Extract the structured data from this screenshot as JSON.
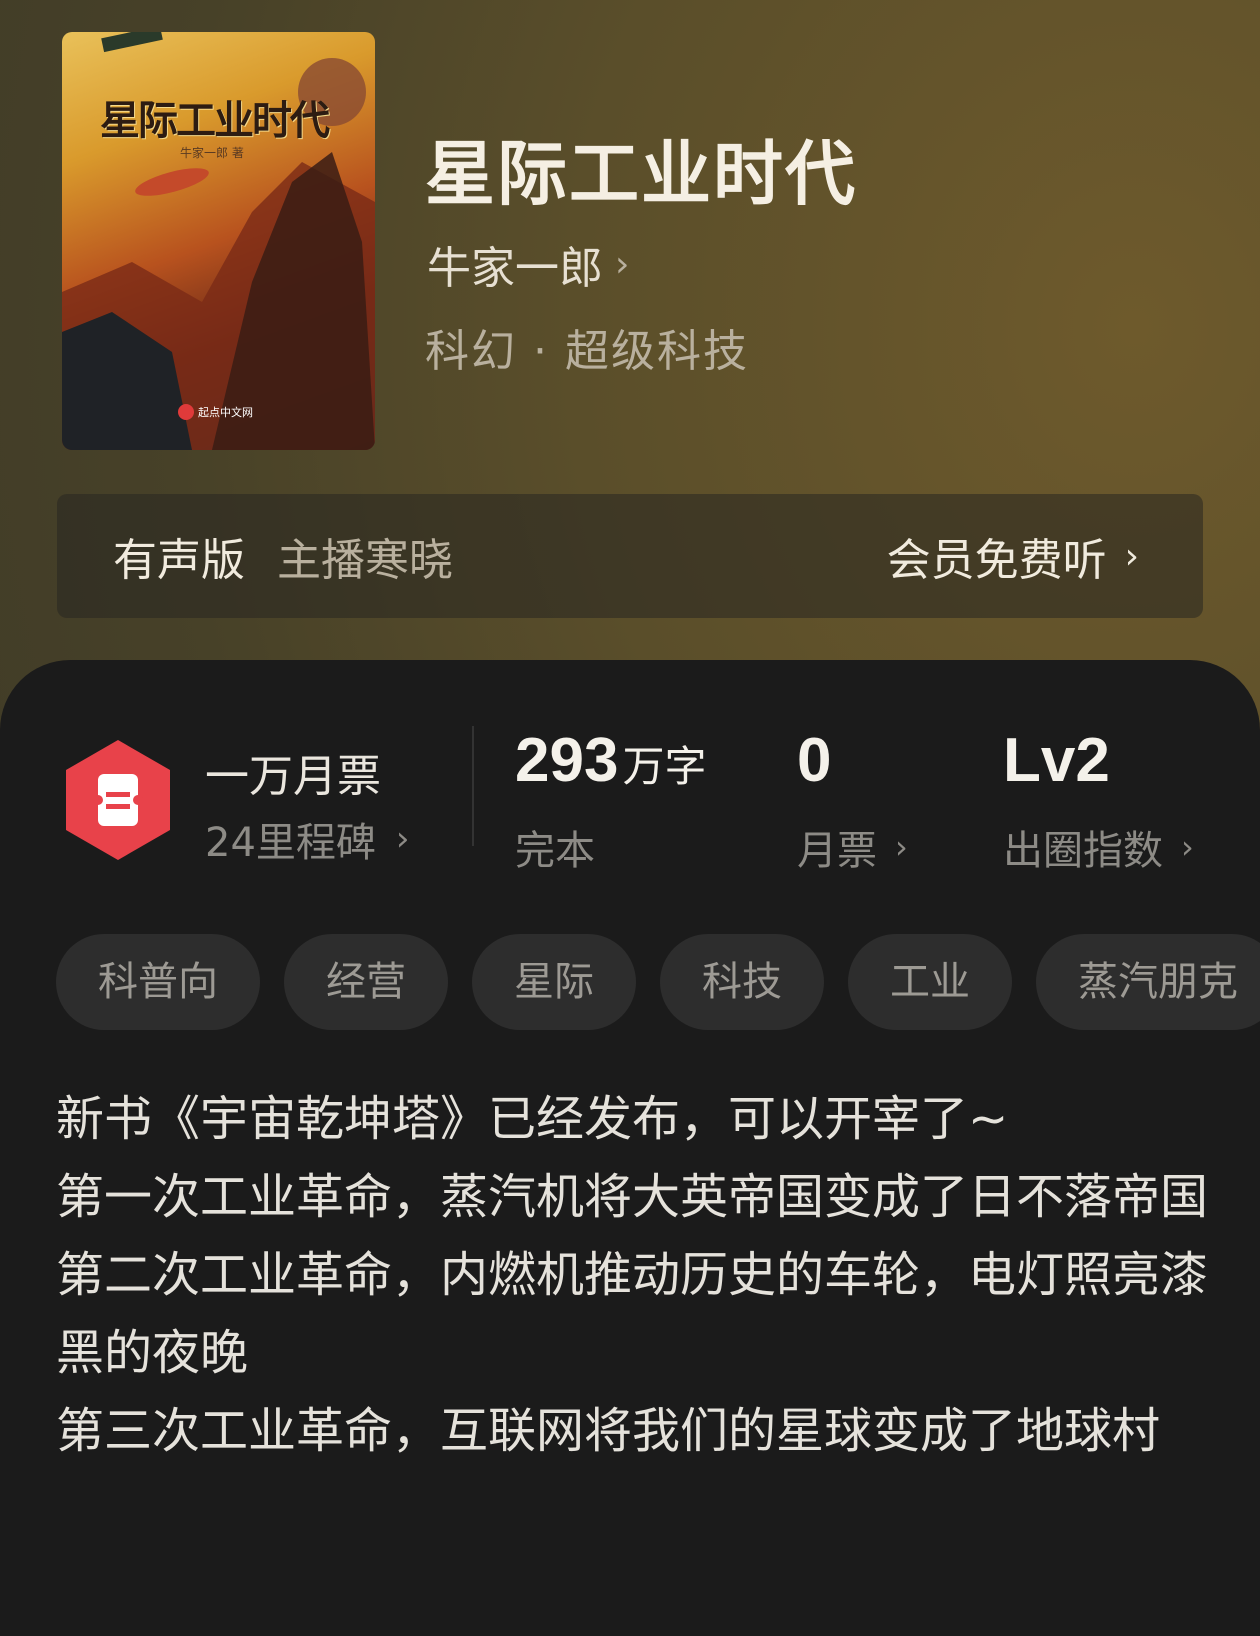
{
  "book": {
    "cover_title": "星际工业时代",
    "cover_author": "牛家一郎 著",
    "cover_publisher": "起点中文网",
    "title": "星际工业时代",
    "author": "牛家一郎",
    "genre": "科幻 · 超级科技"
  },
  "audio": {
    "label": "有声版",
    "host": "主播寒晓",
    "action": "会员免费听"
  },
  "stats": {
    "ticket_title": "一万月票",
    "ticket_sub": "24里程碑",
    "words_value": "293",
    "words_unit": "万字",
    "words_label": "完本",
    "monthly_value": "0",
    "monthly_label": "月票",
    "level_value": "Lv2",
    "level_label": "出圈指数"
  },
  "tags": [
    "科普向",
    "经营",
    "星际",
    "科技",
    "工业",
    "蒸汽朋克"
  ],
  "description": [
    "新书《宇宙乾坤塔》已经发布，可以开宰了~",
    "第一次工业革命，蒸汽机将大英帝国变成了日不落帝国",
    "第二次工业革命，内燃机推动历史的车轮，电灯照亮漆黑的夜晚",
    "第三次工业革命，互联网将我们的星球变成了地球村"
  ],
  "colors": {
    "ticket_red": "#e8424a",
    "panel_bg": "#1b1b1b"
  }
}
